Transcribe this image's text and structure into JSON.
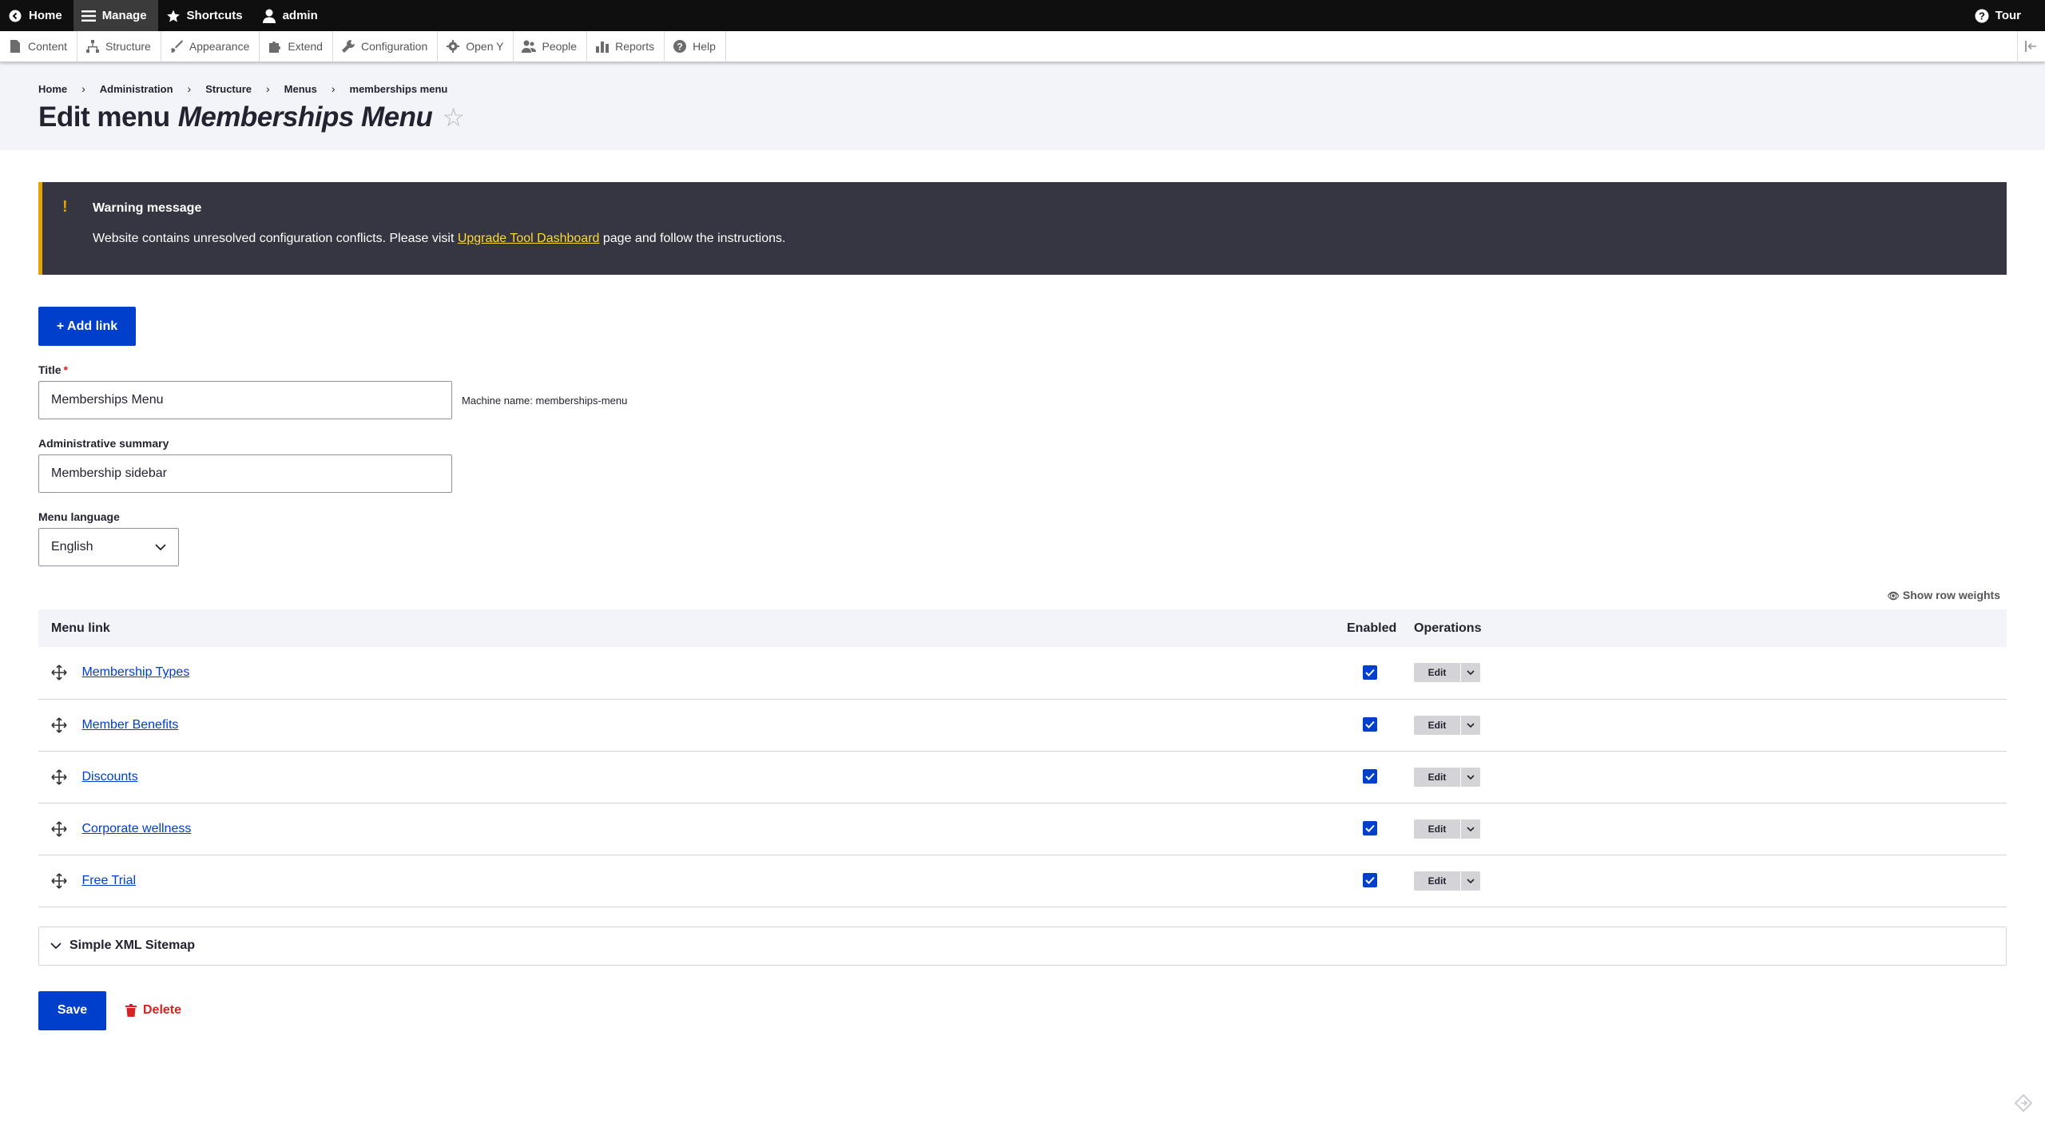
{
  "toolbar": {
    "home": "Home",
    "manage": "Manage",
    "shortcuts": "Shortcuts",
    "user": "admin",
    "tour": "Tour"
  },
  "tray": {
    "items": [
      "Content",
      "Structure",
      "Appearance",
      "Extend",
      "Configuration",
      "Open Y",
      "People",
      "Reports",
      "Help"
    ]
  },
  "breadcrumb": [
    "Home",
    "Administration",
    "Structure",
    "Menus",
    "memberships menu"
  ],
  "page": {
    "title_prefix": "Edit menu",
    "title_name": "Memberships Menu"
  },
  "warning": {
    "title": "Warning message",
    "text_before": "Website contains unresolved configuration conflicts. Please visit ",
    "link": "Upgrade Tool Dashboard",
    "text_after": " page and follow the instructions."
  },
  "form": {
    "add_link": "+ Add link",
    "title_label": "Title",
    "title_value": "Memberships Menu",
    "machine_name": "Machine name: memberships-menu",
    "summary_label": "Administrative summary",
    "summary_value": "Membership sidebar",
    "language_label": "Menu language",
    "language_value": "English"
  },
  "table": {
    "show_weights": "Show row weights",
    "headers": {
      "link": "Menu link",
      "enabled": "Enabled",
      "operations": "Operations"
    },
    "rows": [
      {
        "label": "Membership Types",
        "enabled": true,
        "op": "Edit"
      },
      {
        "label": "Member Benefits",
        "enabled": true,
        "op": "Edit"
      },
      {
        "label": "Discounts",
        "enabled": true,
        "op": "Edit"
      },
      {
        "label": "Corporate wellness",
        "enabled": true,
        "op": "Edit"
      },
      {
        "label": "Free Trial",
        "enabled": true,
        "op": "Edit"
      }
    ]
  },
  "sitemap": {
    "label": "Simple XML Sitemap"
  },
  "actions": {
    "save": "Save",
    "delete": "Delete"
  },
  "colors": {
    "primary": "#003ecc",
    "warning_bg": "#353641",
    "warning_accent": "#e2a400",
    "danger": "#d72222"
  }
}
